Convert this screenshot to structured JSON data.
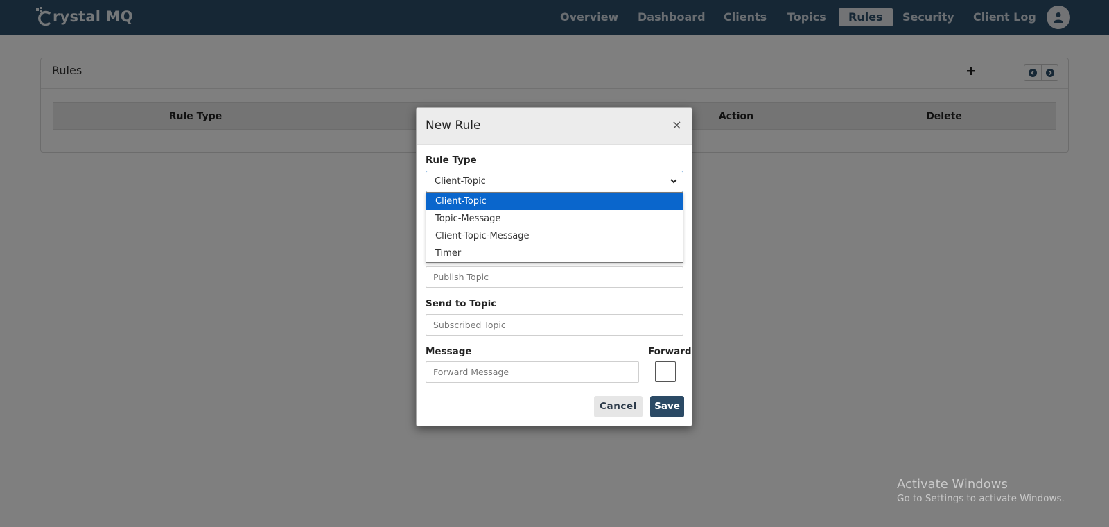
{
  "navbar": {
    "brand": "rystal MQ",
    "items": [
      {
        "label": "Overview",
        "active": false
      },
      {
        "label": "Dashboard",
        "active": false
      },
      {
        "label": "Clients",
        "active": false
      },
      {
        "label": "Topics",
        "active": false
      },
      {
        "label": "Rules",
        "active": true
      },
      {
        "label": "Security",
        "active": false
      },
      {
        "label": "Client Log",
        "active": false
      }
    ]
  },
  "page": {
    "card_title": "Rules",
    "add_icon": "plus-icon",
    "table_headers": [
      "Rule Type",
      "Action",
      "Delete"
    ]
  },
  "modal": {
    "title": "New Rule",
    "close": "×",
    "rule_type_label": "Rule Type",
    "rule_type_value": "Client-Topic",
    "rule_type_options": [
      "Client-Topic",
      "Topic-Message",
      "Client-Topic-Message",
      "Timer"
    ],
    "publish_topic_placeholder": "Publish Topic",
    "send_to_topic_label": "Send to Topic",
    "subscribed_topic_placeholder": "Subscribed Topic",
    "message_label": "Message",
    "forward_label": "Forward",
    "forward_message_placeholder": "Forward Message",
    "cancel_label": "Cancel",
    "save_label": "Save"
  },
  "watermark": {
    "title": "Activate Windows",
    "subtitle": "Go to Settings to activate Windows."
  },
  "colors": {
    "navbar": "#2d4e6b",
    "selected_option": "#0a66cc",
    "save_button": "#2b4a65"
  }
}
